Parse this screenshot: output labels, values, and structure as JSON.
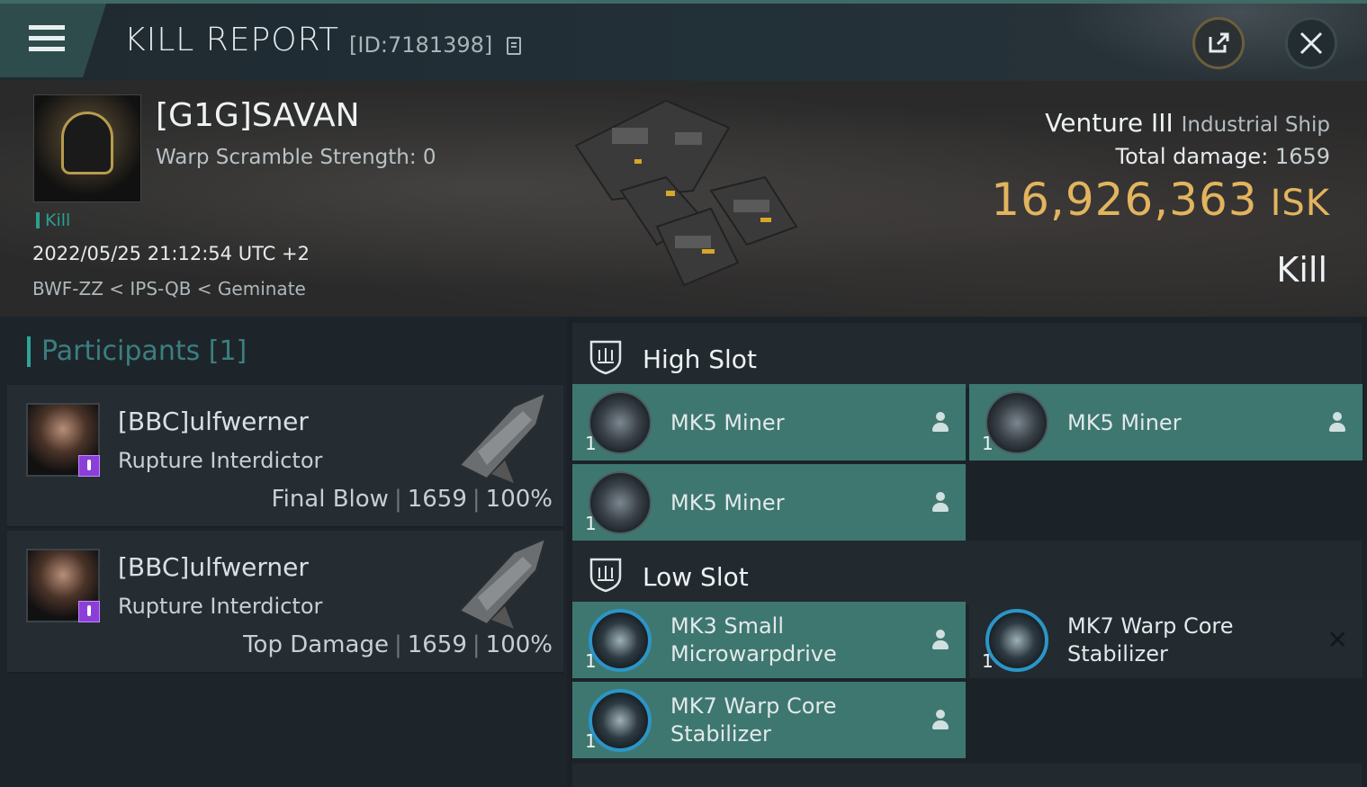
{
  "header": {
    "title": "KILL REPORT",
    "kill_id": "[ID:7181398]",
    "menu_icon": "hamburger-icon",
    "share_icon": "external-link-icon",
    "close_icon": "close-icon"
  },
  "victim": {
    "name": "[G1G]SAVAN",
    "warp_scramble": "Warp Scramble Strength: 0",
    "kill_tag": "Kill",
    "timestamp": "2022/05/25 21:12:54 UTC +2",
    "location": "BWF-ZZ < IPS-QB < Geminate",
    "ship_name": "Venture III",
    "ship_class": "Industrial Ship",
    "total_damage_label": "Total damage:",
    "total_damage_value": "1659",
    "isk_value": "16,926,363",
    "isk_unit": "ISK",
    "result": "Kill"
  },
  "participants": {
    "header": "Participants [1]",
    "rows": [
      {
        "name": "[BBC]ulfwerner",
        "ship": "Rupture Interdictor",
        "role": "Final Blow",
        "damage": "1659",
        "percent": "100%"
      },
      {
        "name": "[BBC]ulfwerner",
        "ship": "Rupture Interdictor",
        "role": "Top Damage",
        "damage": "1659",
        "percent": "100%"
      }
    ]
  },
  "fitting": {
    "high_slot": {
      "label": "High Slot",
      "modules": [
        {
          "name": "MK5 Miner",
          "qty": "1"
        },
        {
          "name": "MK5 Miner",
          "qty": "1"
        },
        {
          "name": "MK5 Miner",
          "qty": "1"
        }
      ]
    },
    "low_slot": {
      "label": "Low Slot",
      "modules": [
        {
          "name_line1": "MK3 Small",
          "name_line2": "Microwarpdrive",
          "qty": "1"
        },
        {
          "name_line1": "MK7 Warp Core",
          "name_line2": "Stabilizer",
          "qty": "1",
          "status": "destroyed"
        },
        {
          "name_line1": "MK7 Warp Core",
          "name_line2": "Stabilizer",
          "qty": "1"
        }
      ]
    }
  },
  "colors": {
    "accent_teal": "#2ea59a",
    "isk_gold": "#e2b45e",
    "module_fitted": "#3e7770",
    "module_destroyed": "#232a30",
    "corp_badge": "#8b3ed8"
  }
}
